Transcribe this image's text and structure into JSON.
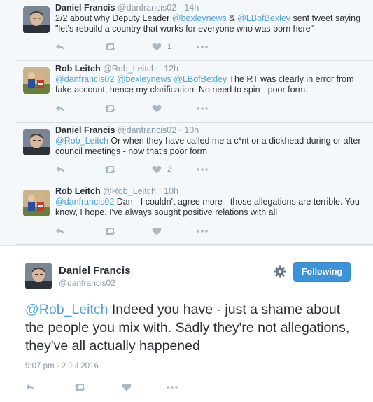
{
  "thread": [
    {
      "name": "Daniel Francis",
      "handle": "@danfrancis02",
      "time": "14h",
      "avatar": "avatar-daniel",
      "segments": [
        {
          "t": "2/2 about why Deputy Leader "
        },
        {
          "t": "@bexleynews",
          "m": true
        },
        {
          "t": " & "
        },
        {
          "t": "@LBofBexley",
          "m": true
        },
        {
          "t": " sent tweet saying \"let's rebuild a country that works for everyone who was born here\""
        }
      ],
      "likes": "1"
    },
    {
      "name": "Rob Leitch",
      "handle": "@Rob_Leitch",
      "time": "12h",
      "avatar": "avatar-rob",
      "segments": [
        {
          "t": "@danfrancis02",
          "m": true
        },
        {
          "t": " "
        },
        {
          "t": "@bexleynews",
          "m": true
        },
        {
          "t": " "
        },
        {
          "t": "@LBofBexley",
          "m": true
        },
        {
          "t": " The RT was clearly in error from fake account, hence my clarification. No need to spin - poor form."
        }
      ],
      "likes": ""
    },
    {
      "name": "Daniel Francis",
      "handle": "@danfrancis02",
      "time": "10h",
      "avatar": "avatar-daniel",
      "segments": [
        {
          "t": "@Rob_Leitch",
          "m": true
        },
        {
          "t": " Or when they have called me a c*nt or a dickhead during or after council meetings - now that's poor form"
        }
      ],
      "likes": "2"
    },
    {
      "name": "Rob Leitch",
      "handle": "@Rob_Leitch",
      "time": "10h",
      "avatar": "avatar-rob",
      "segments": [
        {
          "t": "@danfrancis02",
          "m": true
        },
        {
          "t": " Dan - I couldn't agree more - those allegations are terrible. You know, I hope, I've always sought positive relations with all"
        }
      ],
      "likes": ""
    }
  ],
  "focused": {
    "name": "Daniel Francis",
    "handle": "@danfrancis02",
    "follow_label": "Following",
    "segments": [
      {
        "t": "@Rob_Leitch",
        "m": true
      },
      {
        "t": " Indeed you have - just a shame about the people you mix with. Sadly they're not allegations, they've all actually happened"
      }
    ],
    "timestamp": "9:07 pm - 2 Jul 2016"
  },
  "separator": "·",
  "colors": {
    "mention": "#4fa3d9",
    "follow_button": "#3b94d9",
    "thread_bg": "#f5f8fa",
    "icon_gray": "#aab8c2"
  },
  "icons": [
    "reply-icon",
    "retweet-icon",
    "like-icon",
    "more-icon",
    "gear-icon"
  ]
}
